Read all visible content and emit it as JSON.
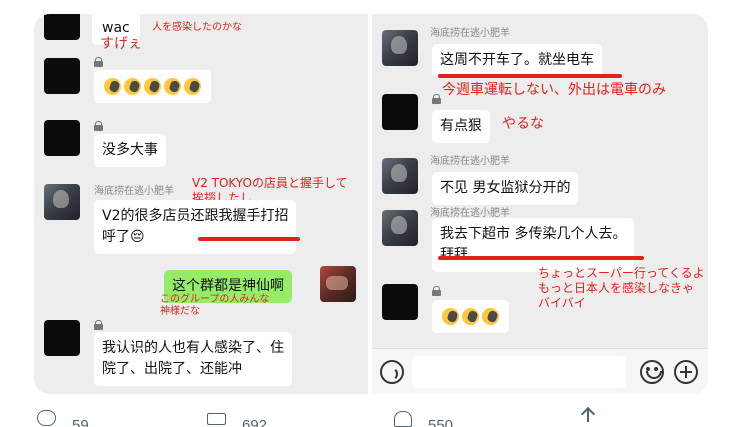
{
  "left_chat": {
    "top_note": "人を感染したのかな",
    "top_bubble": "wac",
    "top_bubble_note": "すげぇ",
    "msg_emoji_count": 5,
    "msg_nothing": "没多大事",
    "sender_name": "海底捞在逃小肥羊",
    "note_v2": [
      "V2 TOKYOの店員と握手して",
      "挨拶したし"
    ],
    "msg_v2": [
      "V2的很多店员还跟我握手打招",
      "呼了😔"
    ],
    "msg_green": "这个群都是神仙啊",
    "note_green": [
      "このグループの人みんな",
      "神様だな"
    ],
    "msg_infected": [
      "我认识的人也有人感染了、住",
      "院了、出院了、还能冲"
    ]
  },
  "right_chat": {
    "sender_name": "海底捞在逃小肥羊",
    "msg_no_drive": "这周不开车了。就坐电车",
    "note_no_drive": "今週車運転しない、外出は電車のみ",
    "msg_fierce": "有点狠",
    "note_fierce": "やるな",
    "msg_separate": "不见 男女监狱分开的",
    "msg_supermarket": [
      "我去下超市 多传染几个人去。",
      "拜拜"
    ],
    "note_supermarket": [
      "ちょっとスーパー行ってくるよ",
      "もっと日本人を感染しなきゃ",
      "バイバイ"
    ],
    "msg_emoji_count": 3
  },
  "input_bar": {
    "voice_icon": "voice-icon",
    "emoji_icon": "emoji-icon",
    "plus_icon": "plus-icon"
  },
  "tweet_actions": {
    "reply_count": "59",
    "retweet_count": "692",
    "like_count": "550"
  },
  "colors": {
    "annotation": "#e0211c",
    "green_bubble": "#95ec69",
    "chat_bg": "#ededed"
  }
}
